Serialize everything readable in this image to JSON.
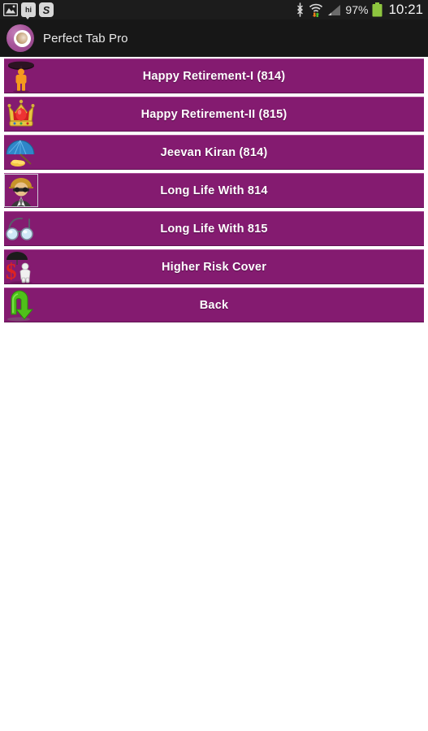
{
  "status_bar": {
    "left_icons": [
      {
        "name": "gallery-image-icon",
        "glyph": "⛰"
      },
      {
        "name": "hi-notification-icon",
        "label": "hi"
      },
      {
        "name": "swirl-app-icon",
        "label": "S"
      }
    ],
    "bluetooth_icon": "bluetooth",
    "wifi_icon": "wifi-data-transfer",
    "signal_icon": "cellular-signal",
    "battery_percent": "97%",
    "battery_icon": "battery-full",
    "clock": "10:21"
  },
  "app_bar": {
    "logo_name": "perfect-tab-pro-logo",
    "title": "Perfect Tab Pro"
  },
  "theme": {
    "row_purple": "#841b70",
    "row_highlight": "#a84b96",
    "row_shadow": "#5f1252",
    "page_background": "#ffffff",
    "status_bar_background": "#1c1c1c",
    "app_bar_background": "#171717",
    "label_color": "#ffffff",
    "battery_green": "#8ec63f"
  },
  "list": {
    "items": [
      {
        "label": "Happy Retirement-I (814)",
        "icon": "person-under-umbrella-icon",
        "framed": false
      },
      {
        "label": "Happy Retirement-II (815)",
        "icon": "crown-icon",
        "framed": false
      },
      {
        "label": "Jeevan Kiran (814)",
        "icon": "blue-umbrella-coins-icon",
        "framed": false
      },
      {
        "label": "Long Life With 814",
        "icon": "man-in-suit-icon",
        "framed": true
      },
      {
        "label": "Long Life With 815",
        "icon": "eyeglasses-icon",
        "framed": false
      },
      {
        "label": "Higher Risk Cover",
        "icon": "dollar-umbrella-person-icon",
        "framed": false
      },
      {
        "label": "Back",
        "icon": "green-back-arrow-icon",
        "framed": false
      }
    ]
  }
}
